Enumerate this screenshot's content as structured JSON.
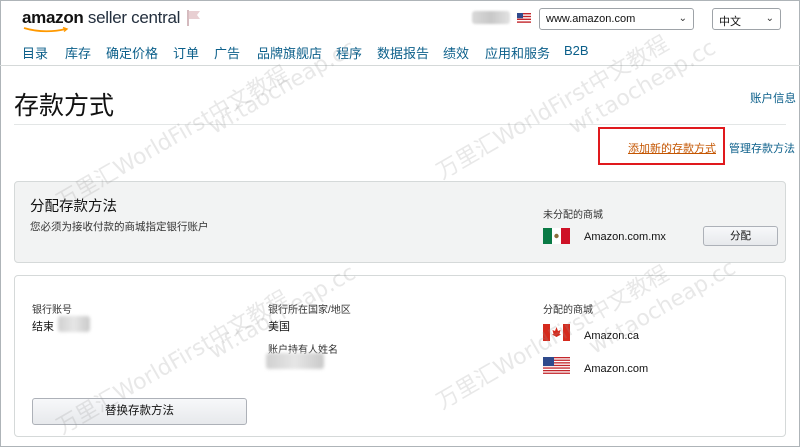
{
  "header": {
    "logo_brand": "amazon",
    "logo_product": " seller central",
    "marketplace_select": "www.amazon.com",
    "language_select": "中文"
  },
  "nav": {
    "items": [
      "目录",
      "库存",
      "确定价格",
      "订单",
      "广告",
      "品牌旗舰店",
      "程序",
      "数据报告",
      "绩效",
      "应用和服务",
      "B2B"
    ]
  },
  "page": {
    "title": "存款方式",
    "account_info_link": "账户信息",
    "add_method_link": "添加新的存款方式",
    "manage_methods_link": "管理存款方法"
  },
  "assign_panel": {
    "title": "分配存款方法",
    "description": "您必须为接收付款的商城指定银行账户",
    "unassigned_label": "未分配的商城",
    "marketplace": "Amazon.com.mx",
    "assign_button": "分配"
  },
  "account_panel": {
    "bank_account_label": "银行账号",
    "bank_account_value": "结束",
    "bank_country_label": "银行所在国家/地区",
    "bank_country_value": "美国",
    "holder_name_label": "账户持有人姓名",
    "assigned_label": "分配的商城",
    "assigned_marketplaces": [
      "Amazon.ca",
      "Amazon.com"
    ],
    "replace_button": "替换存款方法"
  },
  "watermarks": [
    "万里汇WorldFirst中文教程",
    "wf.taocheap.cc"
  ],
  "colors": {
    "link_blue": "#0b5f8a",
    "link_orange": "#c45500",
    "highlight_red": "#e0191d",
    "panel_gray": "#f2f3f3"
  }
}
